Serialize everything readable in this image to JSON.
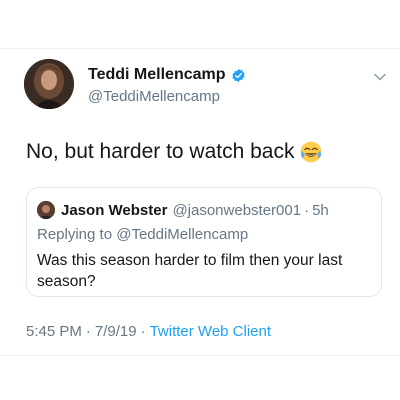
{
  "tweet": {
    "author": {
      "display_name": "Teddi Mellencamp",
      "handle": "@TeddiMellencamp"
    },
    "text": "No, but harder to watch back",
    "emoji": "face-with-tears-of-joy-icon",
    "quoted": {
      "display_name": "Jason Webster",
      "handle": "@jasonwebster001",
      "separator": "·",
      "time": "5h",
      "replying_to": "Replying to ",
      "replying_handle": "@TeddiMellencamp",
      "text": "Was this season harder to film then your last season?"
    },
    "meta": {
      "time": "5:45 PM",
      "separator_1": "·",
      "date": "7/9/19",
      "separator_2": "·",
      "client": "Twitter Web Client"
    }
  },
  "colors": {
    "verified": "#1da1f2",
    "secondary_text": "#657786",
    "link": "#1da1f2",
    "border": "#e1e8ed"
  },
  "icons": [
    "verified-badge-icon",
    "chevron-down-icon",
    "face-with-tears-of-joy-icon"
  ]
}
